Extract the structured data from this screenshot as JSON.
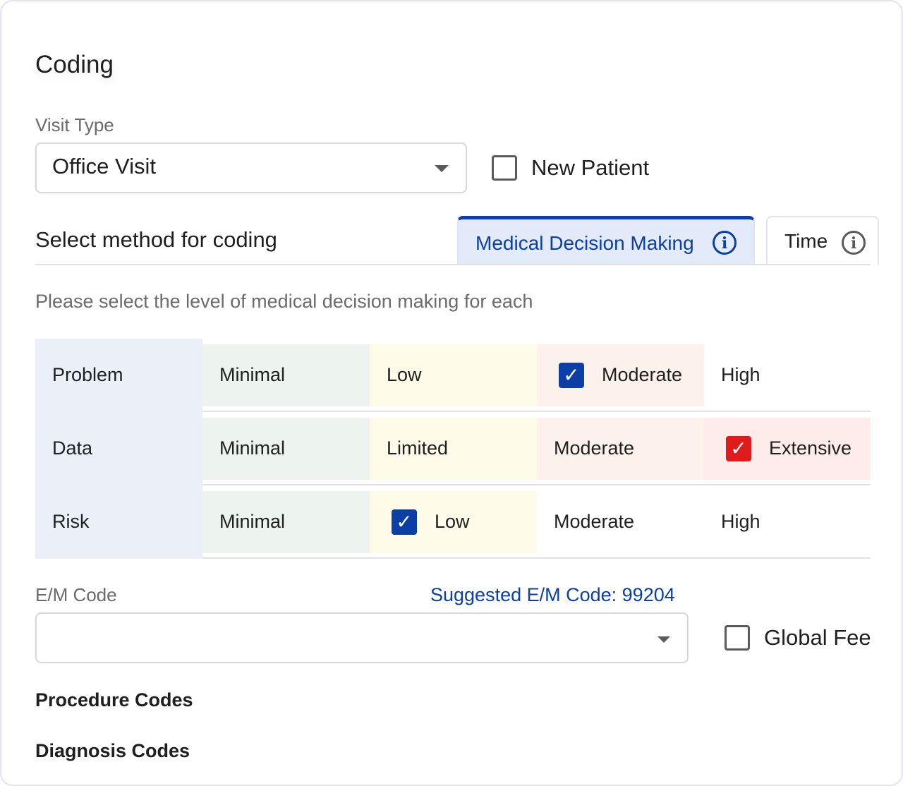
{
  "title": "Coding",
  "visit_type": {
    "label": "Visit Type",
    "value": "Office Visit"
  },
  "new_patient": {
    "label": "New Patient",
    "checked": false
  },
  "method": {
    "label": "Select method for  coding",
    "tabs": [
      {
        "label": "Medical Decision Making",
        "active": true,
        "icon": "info-icon"
      },
      {
        "label": "Time",
        "active": false,
        "icon": "info-icon"
      }
    ]
  },
  "hint": "Please select the level of medical decision making for each",
  "mdm_grid": {
    "rows": [
      {
        "label": "Problem",
        "options": [
          {
            "label": "Minimal",
            "checked": false
          },
          {
            "label": "Low",
            "checked": false
          },
          {
            "label": "Moderate",
            "checked": true
          },
          {
            "label": "High",
            "checked": false
          }
        ]
      },
      {
        "label": "Data",
        "options": [
          {
            "label": "Minimal",
            "checked": false
          },
          {
            "label": "Limited",
            "checked": false
          },
          {
            "label": "Moderate",
            "checked": false
          },
          {
            "label": "Extensive",
            "checked": true
          }
        ]
      },
      {
        "label": "Risk",
        "options": [
          {
            "label": "Minimal",
            "checked": false
          },
          {
            "label": "Low",
            "checked": true
          },
          {
            "label": "Moderate",
            "checked": false
          },
          {
            "label": "High",
            "checked": false
          }
        ]
      }
    ]
  },
  "em_code": {
    "label": "E/M Code",
    "value": "",
    "suggested": "Suggested E/M Code: 99204"
  },
  "global_fee": {
    "label": "Global Fee",
    "checked": false
  },
  "sections": {
    "procedure": "Procedure Codes",
    "diagnosis": "Diagnosis Codes"
  },
  "colors": {
    "accent": "#0b3fa5",
    "check_blue": "#0b3fa5",
    "check_red": "#e01b1b",
    "minimal_bg": "#edf3ee",
    "low_bg": "#fefce8",
    "moderate_bg": "#fdf1ec",
    "high_bg": "#fdecea",
    "row_header_bg": "#ebeff8"
  }
}
